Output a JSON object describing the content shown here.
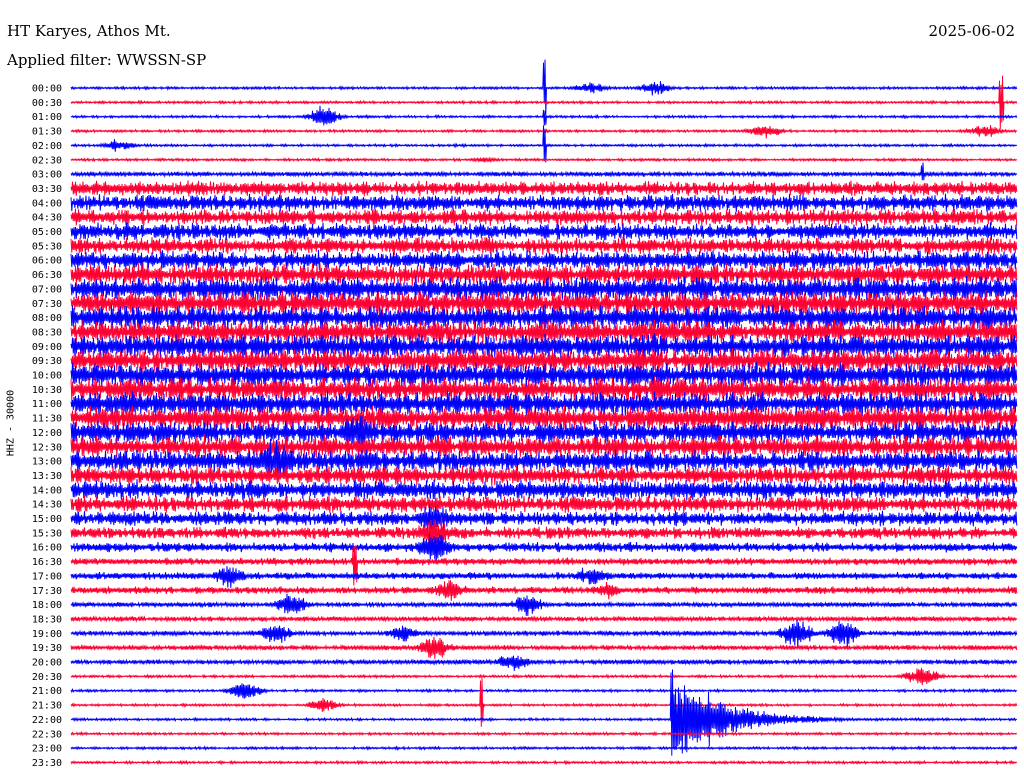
{
  "header": {
    "station": "HT Karyes, Athos Mt.",
    "filter": "Applied filter: WWSSN-SP",
    "date": "2025-06-02",
    "channel": "HHZ - 30000"
  },
  "colors": {
    "odd_trace": "#0000ff",
    "even_trace": "#ff0033",
    "background": "#ffffff",
    "text": "#000000"
  },
  "chart_data": {
    "type": "line",
    "title": "HT Karyes, Athos Mt.",
    "subtitle": "Applied filter: WWSSN-SP",
    "ylabel": "HHZ - 30000",
    "y_tick_labels": [
      "00:00",
      "00:30",
      "01:00",
      "01:30",
      "02:00",
      "02:30",
      "03:00",
      "03:30",
      "04:00",
      "04:30",
      "05:00",
      "05:30",
      "06:00",
      "06:30",
      "07:00",
      "07:30",
      "08:00",
      "08:30",
      "09:00",
      "09:30",
      "10:00",
      "10:30",
      "11:00",
      "11:30",
      "12:00",
      "12:30",
      "13:00",
      "13:30",
      "14:00",
      "14:30",
      "15:00",
      "15:30",
      "16:00",
      "16:30",
      "17:00",
      "17:30",
      "18:00",
      "18:30",
      "19:00",
      "19:30",
      "20:00",
      "20:30",
      "21:00",
      "21:30",
      "22:00",
      "22:30",
      "23:00",
      "23:30"
    ],
    "trace_noise_level": [
      1,
      1,
      1,
      1,
      1,
      1,
      2,
      6,
      7,
      7,
      7,
      7,
      8,
      9,
      10,
      10,
      10,
      10,
      10,
      10,
      10,
      10,
      10,
      10,
      9,
      9,
      9,
      8,
      8,
      7,
      6,
      5,
      4,
      3,
      3,
      3,
      2,
      2,
      2,
      2,
      2,
      1,
      1,
      1,
      1,
      1,
      1,
      1
    ],
    "events": [
      {
        "trace": 0,
        "minute": 15.0,
        "amplitude": 30,
        "type": "spike"
      },
      {
        "trace": 0,
        "minute": 16.5,
        "amplitude": 7,
        "type": "burst"
      },
      {
        "trace": 0,
        "minute": 18.5,
        "amplitude": 9,
        "type": "burst"
      },
      {
        "trace": 1,
        "minute": 29.5,
        "amplitude": 30,
        "type": "spike"
      },
      {
        "trace": 2,
        "minute": 8.0,
        "amplitude": 12,
        "type": "burst"
      },
      {
        "trace": 2,
        "minute": 15.0,
        "amplitude": 10,
        "type": "spike"
      },
      {
        "trace": 3,
        "minute": 22.0,
        "amplitude": 8,
        "type": "burst"
      },
      {
        "trace": 3,
        "minute": 29.0,
        "amplitude": 8,
        "type": "burst"
      },
      {
        "trace": 4,
        "minute": 1.5,
        "amplitude": 7,
        "type": "burst"
      },
      {
        "trace": 4,
        "minute": 15.0,
        "amplitude": 22,
        "type": "spike"
      },
      {
        "trace": 5,
        "minute": 13.0,
        "amplitude": 3,
        "type": "burst"
      },
      {
        "trace": 6,
        "minute": 27.0,
        "amplitude": 12,
        "type": "spike"
      },
      {
        "trace": 16,
        "minute": 15.0,
        "amplitude": 14,
        "type": "spike"
      },
      {
        "trace": 24,
        "minute": 9.0,
        "amplitude": 22,
        "type": "burst"
      },
      {
        "trace": 26,
        "minute": 6.5,
        "amplitude": 26,
        "type": "burst"
      },
      {
        "trace": 30,
        "minute": 11.5,
        "amplitude": 20,
        "type": "burst"
      },
      {
        "trace": 31,
        "minute": 11.5,
        "amplitude": 22,
        "type": "burst"
      },
      {
        "trace": 32,
        "minute": 11.5,
        "amplitude": 22,
        "type": "burst"
      },
      {
        "trace": 33,
        "minute": 9.0,
        "amplitude": 28,
        "type": "spike"
      },
      {
        "trace": 34,
        "minute": 5.0,
        "amplitude": 14,
        "type": "burst"
      },
      {
        "trace": 34,
        "minute": 16.5,
        "amplitude": 12,
        "type": "burst"
      },
      {
        "trace": 35,
        "minute": 12.0,
        "amplitude": 14,
        "type": "burst"
      },
      {
        "trace": 35,
        "minute": 17.0,
        "amplitude": 10,
        "type": "burst"
      },
      {
        "trace": 36,
        "minute": 7.0,
        "amplitude": 14,
        "type": "burst"
      },
      {
        "trace": 36,
        "minute": 14.5,
        "amplitude": 14,
        "type": "burst"
      },
      {
        "trace": 38,
        "minute": 6.5,
        "amplitude": 12,
        "type": "burst"
      },
      {
        "trace": 38,
        "minute": 10.5,
        "amplitude": 10,
        "type": "burst"
      },
      {
        "trace": 38,
        "minute": 23.0,
        "amplitude": 18,
        "type": "burst"
      },
      {
        "trace": 38,
        "minute": 24.5,
        "amplitude": 16,
        "type": "burst"
      },
      {
        "trace": 39,
        "minute": 11.5,
        "amplitude": 16,
        "type": "burst"
      },
      {
        "trace": 40,
        "minute": 14.0,
        "amplitude": 10,
        "type": "burst"
      },
      {
        "trace": 41,
        "minute": 27.0,
        "amplitude": 14,
        "type": "burst"
      },
      {
        "trace": 42,
        "minute": 5.5,
        "amplitude": 12,
        "type": "burst"
      },
      {
        "trace": 43,
        "minute": 8.0,
        "amplitude": 8,
        "type": "burst"
      },
      {
        "trace": 43,
        "minute": 13.0,
        "amplitude": 30,
        "type": "spike"
      },
      {
        "trace": 44,
        "minute": 19.0,
        "amplitude": 60,
        "type": "quake"
      }
    ]
  }
}
